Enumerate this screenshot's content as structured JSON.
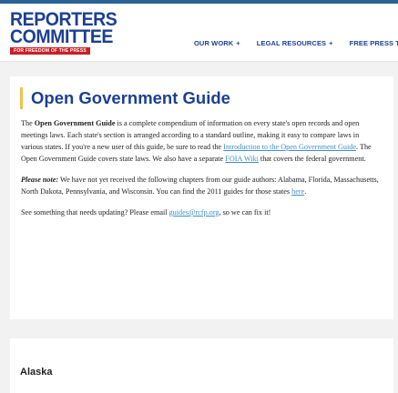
{
  "header": {
    "logo": {
      "line1": "REPORTERS",
      "line2": "COMMITTEE",
      "tagline": "FOR FREEDOM OF THE PRESS"
    },
    "nav": [
      {
        "label": "OUR WORK",
        "suffix": "+"
      },
      {
        "label": "LEGAL RESOURCES",
        "suffix": "+"
      },
      {
        "label": "FREE PRESS TO",
        "suffix": ""
      }
    ]
  },
  "main": {
    "title": "Open Government Guide",
    "p1": {
      "intro": "The ",
      "guide_name": "Open Government Guide",
      "text1": " is a complete compendium of information on every state's open records and open meetings laws. Each state's section is arranged according to a standard outline, making it easy to compare laws in various states. If you're a new user of this guide, be sure to read the ",
      "link_intro": "Introduction to the Open Government Guide",
      "text2": ".  The Open Government Guide covers state laws. We also have a separate ",
      "link_foia": "FOIA Wiki",
      "text3": " that covers the federal government."
    },
    "p2": {
      "note_label": "Please note:",
      "text1": " We have not yet received the following chapters from our guide authors: Alabama, Florida, Massachusetts, North Dakota, Pennsylvania, and Wisconsin. You can find the 2011 guides for those states ",
      "link_here": "here",
      "text2": "."
    },
    "p3": {
      "text1": "See something that needs updating?  Please email ",
      "link_email": "guides@rcfp.org",
      "text2": ", so we can fix it!"
    }
  },
  "section": {
    "title": "Alaska"
  },
  "colors": {
    "brand_blue": "#1c3f94",
    "brand_red": "#cc1f25",
    "accent_yellow": "#f3c24a",
    "link": "#3e8fc5"
  }
}
